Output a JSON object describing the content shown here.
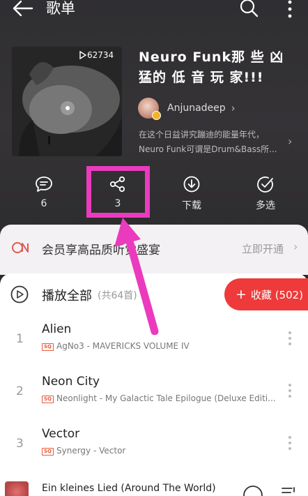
{
  "header": {
    "title": "歌单",
    "icons": [
      "back-arrow",
      "search",
      "more-vertical"
    ]
  },
  "playlist": {
    "play_count": "62734",
    "title": "Neuro Funk那 些 凶 猛的 低 音 玩 家!!!",
    "creator": "Anjunadeep",
    "description": "在这个日益讲究蹦迪的能量年代，Neuro Funk可谓是Drum&Bass所..."
  },
  "actions": [
    {
      "id": "comment",
      "label": "6"
    },
    {
      "id": "share",
      "label": "3"
    },
    {
      "id": "download",
      "label": "下载"
    },
    {
      "id": "multi_select",
      "label": "多选"
    }
  ],
  "vip_banner": {
    "text": "会员享高品质听觉盛宴",
    "action": "立即开通"
  },
  "list": {
    "play_all_label": "播放全部",
    "play_all_count": "(共64首)",
    "collect_label": "收藏 (502)",
    "songs": [
      {
        "index": "1",
        "title": "Alien",
        "badge": "SQ",
        "subtitle": "AgNo3 - MAVERICKS VOLUME IV"
      },
      {
        "index": "2",
        "title": "Neon City",
        "badge": "SQ",
        "subtitle": "Neonlight - My Galactic Tale Epilogue (Deluxe Editi..."
      },
      {
        "index": "3",
        "title": "Vector",
        "badge": "SQ",
        "subtitle": "Synergy - Vector"
      }
    ]
  },
  "mini_player": {
    "title": "Ein kleines Lied (Around The World)"
  },
  "colors": {
    "accent_red": "#ee3a3a",
    "highlight_magenta": "#ea3bbf",
    "header_bg": "#2f2e31"
  }
}
